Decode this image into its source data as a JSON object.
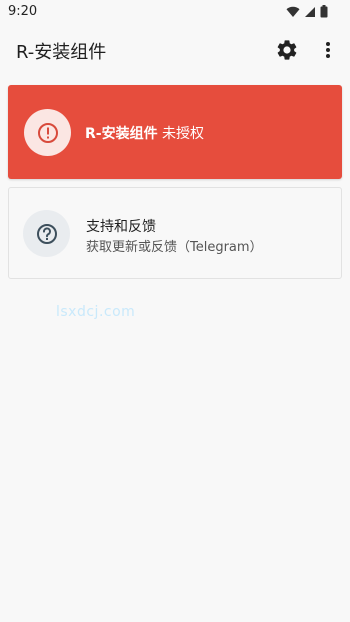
{
  "status_bar": {
    "time": "9:20"
  },
  "app_bar": {
    "title": "R-安装组件"
  },
  "status_card": {
    "app_name": "R-安装组件",
    "status_text": "未授权",
    "color": "#e64d3d"
  },
  "support_card": {
    "title": "支持和反馈",
    "subtitle": "获取更新或反馈（Telegram）"
  },
  "watermark": {
    "text": "lsxdcj.com"
  },
  "icons": [
    "wifi-icon",
    "signal-icon",
    "battery-icon",
    "gear-icon",
    "more-vert-icon",
    "alert-icon",
    "help-icon"
  ]
}
